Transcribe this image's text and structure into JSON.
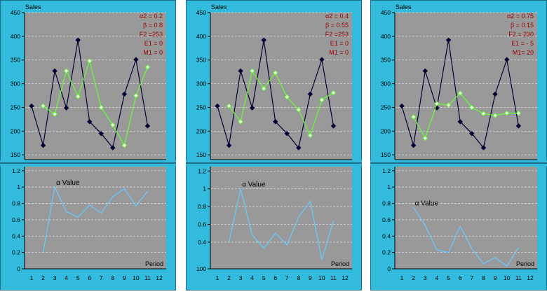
{
  "chart_data": [
    {
      "type": "line",
      "ylabel": "Sales",
      "xlabel": "Period",
      "x_ticks": [
        "1",
        "2",
        "3",
        "4",
        "5",
        "6",
        "7",
        "8",
        "9",
        "10",
        "11",
        "12"
      ],
      "params": [
        "α2 = 0.2",
        "β = 0.8",
        "F2 =253",
        "E1 = 0",
        "M1 = 0"
      ],
      "upper": {
        "ylim": [
          140,
          450
        ],
        "y_ticks": [
          "150",
          "200",
          "250",
          "300",
          "350",
          "400",
          "450"
        ],
        "series": [
          {
            "color": "#000033",
            "x": [
              1,
              2,
              3,
              4,
              5,
              6,
              7,
              8,
              9,
              10,
              11
            ],
            "values": [
              253,
              170,
              327,
              249,
              392,
              220,
              195,
              165,
              278,
              351,
              211
            ]
          },
          {
            "color": "#66ff33",
            "x": [
              2,
              3,
              4,
              5,
              6,
              7,
              8,
              9,
              10,
              11
            ],
            "values": [
              253,
              236,
              327,
              273,
              348,
              250,
              213,
              170,
              275,
              335
            ]
          }
        ]
      },
      "lower": {
        "ylim": [
          0,
          1.25
        ],
        "y_ticks": [
          "0",
          "0.2",
          "0.4",
          "0.6",
          "0.8",
          "1",
          "1.2"
        ],
        "annotation": "α Value",
        "series": [
          {
            "color": "#66ccff",
            "x": [
              2,
              3,
              4,
              5,
              6,
              7,
              8,
              9,
              10,
              11
            ],
            "values": [
              0.2,
              1.0,
              0.7,
              0.63,
              0.78,
              0.68,
              0.88,
              0.98,
              0.77,
              0.95
            ]
          }
        ]
      }
    },
    {
      "type": "line",
      "ylabel": "Sales",
      "xlabel": "Period",
      "x_ticks": [
        "1",
        "2",
        "3",
        "4",
        "5",
        "6",
        "7",
        "8",
        "9",
        "10",
        "11",
        "12"
      ],
      "params": [
        "α2 = 0.4",
        "β = 0.55",
        "F2 =253",
        "E1 = 0",
        "M1 = 0"
      ],
      "upper": {
        "ylim": [
          140,
          450
        ],
        "y_ticks": [
          "150",
          "200",
          "250",
          "300",
          "350",
          "400",
          "450"
        ],
        "series": [
          {
            "color": "#000033",
            "x": [
              1,
              2,
              3,
              4,
              5,
              6,
              7,
              8,
              9,
              10,
              11
            ],
            "values": [
              253,
              170,
              327,
              249,
              392,
              220,
              195,
              165,
              278,
              351,
              211
            ]
          },
          {
            "color": "#66ff33",
            "x": [
              2,
              3,
              4,
              5,
              6,
              7,
              8,
              9,
              10,
              11
            ],
            "values": [
              253,
              220,
              327,
              290,
              323,
              272,
              245,
              191,
              266,
              281
            ]
          }
        ]
      },
      "lower": {
        "ylim": [
          0.1,
          1.25
        ],
        "y_ticks": [
          "100",
          "0.4",
          "0.6",
          "0.8",
          "1",
          "1.2"
        ],
        "y_tick_values": [
          0.1,
          0.4,
          0.6,
          0.8,
          1.0,
          1.2
        ],
        "annotation": "α Value",
        "series": [
          {
            "color": "#66ccff",
            "x": [
              2,
              3,
              4,
              5,
              6,
              7,
              8,
              9,
              10,
              11
            ],
            "values": [
              0.4,
              1.0,
              0.48,
              0.33,
              0.5,
              0.37,
              0.68,
              0.86,
              0.2,
              0.64
            ]
          }
        ]
      }
    },
    {
      "type": "line",
      "ylabel": "Sales",
      "xlabel": "Period",
      "x_ticks": [
        "1",
        "2",
        "3",
        "4",
        "5",
        "6",
        "7",
        "8",
        "9",
        "10",
        "11",
        "12"
      ],
      "params": [
        "α2 = 0.75",
        "β = 0.15",
        "F2 = 230",
        "E1 = - 5",
        "M1= 20"
      ],
      "upper": {
        "ylim": [
          140,
          450
        ],
        "y_ticks": [
          "150",
          "200",
          "250",
          "300",
          "350",
          "400",
          "450"
        ],
        "series": [
          {
            "color": "#000033",
            "x": [
              1,
              2,
              3,
              4,
              5,
              6,
              7,
              8,
              9,
              10,
              11
            ],
            "values": [
              253,
              170,
              327,
              249,
              392,
              220,
              195,
              165,
              278,
              351,
              211
            ]
          },
          {
            "color": "#66ff33",
            "x": [
              2,
              3,
              4,
              5,
              6,
              7,
              8,
              9,
              10,
              11
            ],
            "values": [
              230,
              185,
              258,
              255,
              280,
              250,
              237,
              233,
              238,
              238
            ]
          }
        ]
      },
      "lower": {
        "ylim": [
          0,
          1.25
        ],
        "y_ticks": [
          "0",
          "0.2",
          "0.4",
          "0.6",
          "0.8",
          "1",
          "1.2"
        ],
        "annotation": "α Value",
        "series": [
          {
            "color": "#66ccff",
            "x": [
              2,
              3,
              4,
              5,
              6,
              7,
              8,
              9,
              10,
              11
            ],
            "values": [
              0.75,
              0.53,
              0.23,
              0.2,
              0.52,
              0.25,
              0.06,
              0.14,
              0.03,
              0.26
            ]
          }
        ]
      }
    }
  ],
  "colors": {
    "background": "#ffffff",
    "panel": "#33bbdd",
    "frame": "#1e6e8a",
    "plot": "#999999",
    "grid": "#dddddd",
    "params_text": "#990000",
    "label_text": "#000000"
  }
}
